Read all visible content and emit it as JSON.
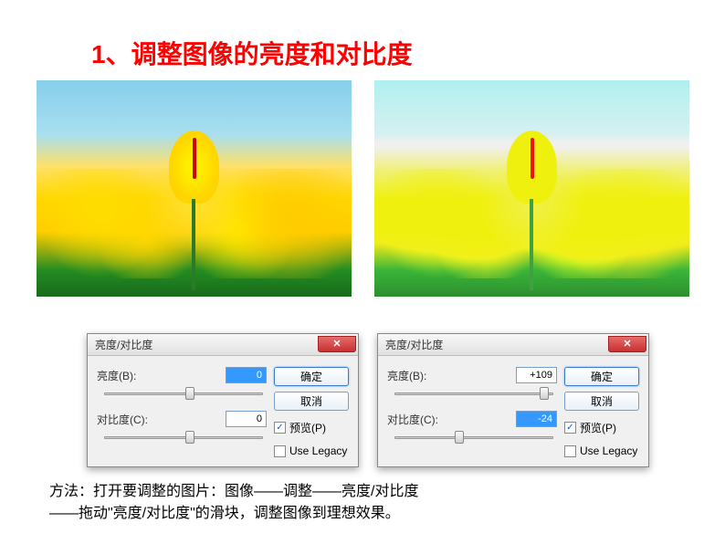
{
  "title": "1、调整图像的亮度和对比度",
  "dialog_left": {
    "title": "亮度/对比度",
    "brightness_label": "亮度(B):",
    "brightness_value": "0",
    "contrast_label": "对比度(C):",
    "contrast_value": "0",
    "ok_label": "确定",
    "cancel_label": "取消",
    "preview_label": "预览(P)",
    "preview_checked": true,
    "legacy_label": "Use Legacy",
    "legacy_checked": false,
    "brightness_thumb_pct": 50,
    "contrast_thumb_pct": 50
  },
  "dialog_right": {
    "title": "亮度/对比度",
    "brightness_label": "亮度(B):",
    "brightness_value": "+109",
    "contrast_label": "对比度(C):",
    "contrast_value": "-24",
    "ok_label": "确定",
    "cancel_label": "取消",
    "preview_label": "预览(P)",
    "preview_checked": true,
    "legacy_label": "Use Legacy",
    "legacy_checked": false,
    "brightness_thumb_pct": 86,
    "contrast_thumb_pct": 38
  },
  "method_text_line1": "方法：打开要调整的图片：图像——调整——亮度/对比度",
  "method_text_line2": "——拖动\"亮度/对比度\"的滑块，调整图像到理想效果。",
  "close_symbol": "✕",
  "check_symbol": "✓"
}
